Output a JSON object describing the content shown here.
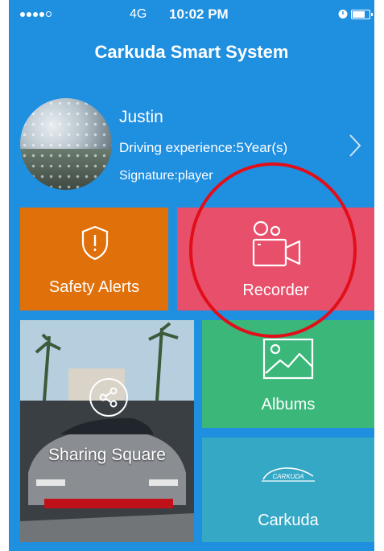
{
  "status_bar": {
    "carrier": "4G",
    "time": "10:02 PM",
    "icons": [
      "signal-dots-icon",
      "alarm-icon",
      "battery-icon"
    ]
  },
  "header": {
    "title": "Carkuda Smart System"
  },
  "profile": {
    "name": "Justin",
    "driving_experience": "Driving experience:5Year(s)",
    "signature": "Signature:player"
  },
  "tiles": {
    "safety_alerts": {
      "label": "Safety Alerts",
      "icon": "shield-alert-icon",
      "color": "#e0700a"
    },
    "recorder": {
      "label": "Recorder",
      "icon": "video-camera-icon",
      "color": "#e84f6a"
    },
    "sharing_square": {
      "label": "Sharing Square",
      "icon": "share-icon"
    },
    "albums": {
      "label": "Albums",
      "icon": "image-icon",
      "color": "#3bb77a"
    },
    "carkuda": {
      "label": "Carkuda",
      "logo_text": "CARKUDA",
      "color": "#35a8c6"
    }
  },
  "annotation": {
    "highlight": "recorder",
    "color": "#e10f1a"
  }
}
